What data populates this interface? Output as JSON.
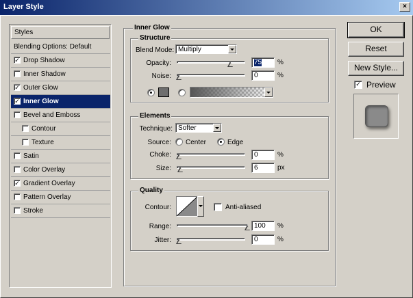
{
  "window": {
    "title": "Layer Style",
    "close_glyph": "×"
  },
  "styles_list": {
    "header": "Styles",
    "items": [
      {
        "label": "Blending Options: Default",
        "checkbox": false,
        "checked": false,
        "selected": false,
        "indent": 0
      },
      {
        "label": "Drop Shadow",
        "checkbox": true,
        "checked": true,
        "selected": false,
        "indent": 0
      },
      {
        "label": "Inner Shadow",
        "checkbox": true,
        "checked": false,
        "selected": false,
        "indent": 0
      },
      {
        "label": "Outer Glow",
        "checkbox": true,
        "checked": true,
        "selected": false,
        "indent": 0
      },
      {
        "label": "Inner Glow",
        "checkbox": true,
        "checked": true,
        "selected": true,
        "indent": 0
      },
      {
        "label": "Bevel and Emboss",
        "checkbox": true,
        "checked": false,
        "selected": false,
        "indent": 0
      },
      {
        "label": "Contour",
        "checkbox": true,
        "checked": false,
        "selected": false,
        "indent": 1
      },
      {
        "label": "Texture",
        "checkbox": true,
        "checked": false,
        "selected": false,
        "indent": 1
      },
      {
        "label": "Satin",
        "checkbox": true,
        "checked": false,
        "selected": false,
        "indent": 0
      },
      {
        "label": "Color Overlay",
        "checkbox": true,
        "checked": false,
        "selected": false,
        "indent": 0
      },
      {
        "label": "Gradient Overlay",
        "checkbox": true,
        "checked": true,
        "selected": false,
        "indent": 0
      },
      {
        "label": "Pattern Overlay",
        "checkbox": true,
        "checked": false,
        "selected": false,
        "indent": 0
      },
      {
        "label": "Stroke",
        "checkbox": true,
        "checked": false,
        "selected": false,
        "indent": 0
      }
    ]
  },
  "inner_glow": {
    "title": "Inner Glow",
    "structure": {
      "title": "Structure",
      "blend_mode_label": "Blend Mode:",
      "blend_mode_value": "Multiply",
      "opacity_label": "Opacity:",
      "opacity_value": "75",
      "opacity_unit": "%",
      "opacity_fraction": 0.75,
      "noise_label": "Noise:",
      "noise_value": "0",
      "noise_unit": "%",
      "noise_fraction": 0,
      "color_mode": "solid",
      "glow_color": "#6e6e6e"
    },
    "elements": {
      "title": "Elements",
      "technique_label": "Technique:",
      "technique_value": "Softer",
      "source_label": "Source:",
      "source_center": "Center",
      "source_edge": "Edge",
      "source_selected": "edge",
      "choke_label": "Choke:",
      "choke_value": "0",
      "choke_unit": "%",
      "choke_fraction": 0,
      "size_label": "Size:",
      "size_value": "6",
      "size_unit": "px",
      "size_fraction": 0.024
    },
    "quality": {
      "title": "Quality",
      "contour_label": "Contour:",
      "anti_aliased_label": "Anti-aliased",
      "anti_aliased_checked": false,
      "range_label": "Range:",
      "range_value": "100",
      "range_unit": "%",
      "range_fraction": 1,
      "jitter_label": "Jitter:",
      "jitter_value": "0",
      "jitter_unit": "%",
      "jitter_fraction": 0
    }
  },
  "buttons": {
    "ok": "OK",
    "reset": "Reset",
    "new_style": "New Style..."
  },
  "preview": {
    "label": "Preview",
    "checked": true
  }
}
